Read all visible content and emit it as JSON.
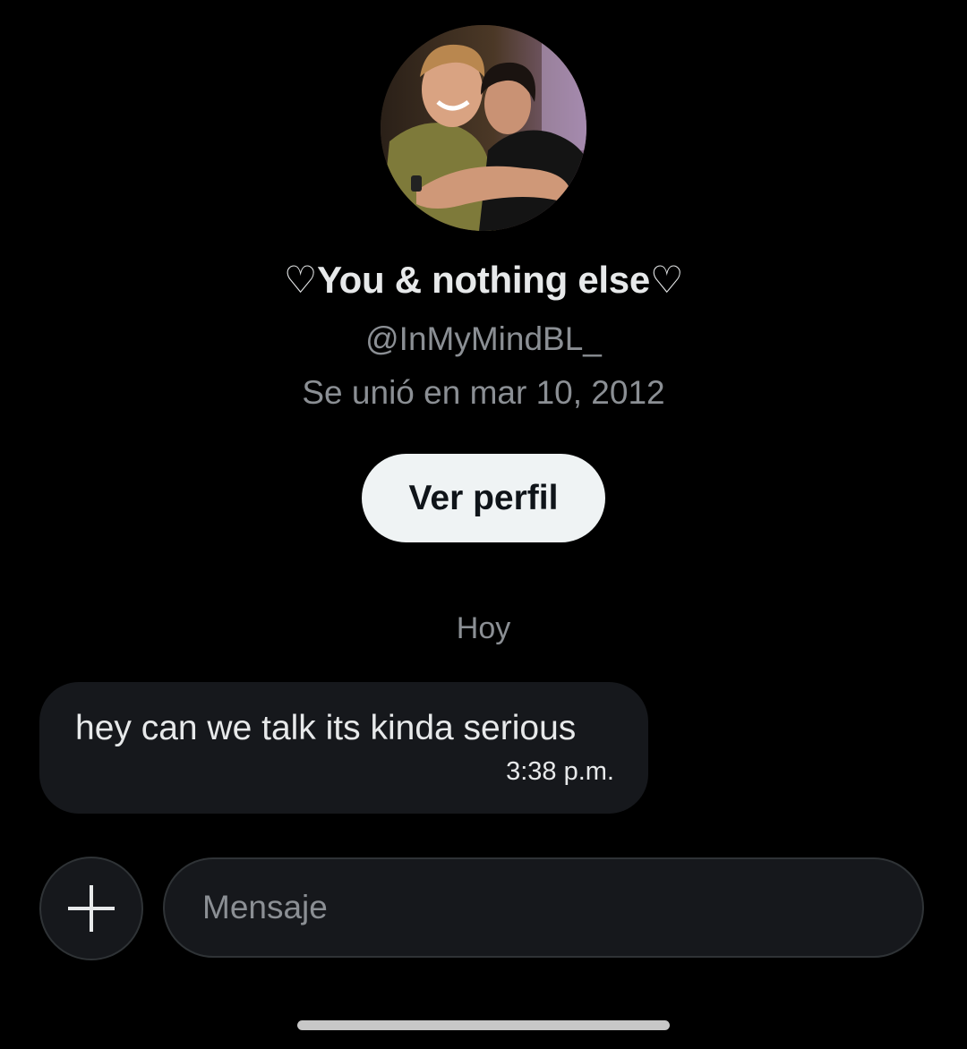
{
  "profile": {
    "display_name": "♡You & nothing else♡",
    "handle": "@InMyMindBL_",
    "joined": "Se unió en mar 10, 2012",
    "view_profile_label": "Ver perfil"
  },
  "conversation": {
    "date_label": "Hoy",
    "messages": [
      {
        "text": "hey can we talk its kinda serious",
        "time": "3:38 p.m."
      }
    ]
  },
  "composer": {
    "placeholder": "Mensaje",
    "add_icon": "plus-icon"
  },
  "colors": {
    "background": "#000000",
    "bubble": "#16181c",
    "secondary_text": "#8b8f94",
    "button_bg": "#eff3f4"
  }
}
